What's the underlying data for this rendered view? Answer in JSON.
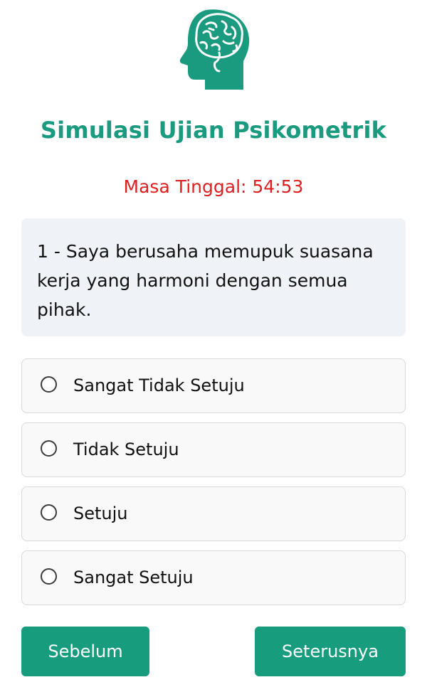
{
  "header": {
    "logo_icon": "head-brain-icon",
    "title": "Simulasi Ujian Psikometrik",
    "timer_text": "Masa Tinggal: 54:53"
  },
  "question": {
    "text": "1 - Saya berusaha memupuk suasana kerja yang harmoni dengan semua pihak."
  },
  "options": [
    {
      "label": "Sangat Tidak Setuju",
      "selected": false
    },
    {
      "label": "Tidak Setuju",
      "selected": false
    },
    {
      "label": "Setuju",
      "selected": false
    },
    {
      "label": "Sangat Setuju",
      "selected": false
    }
  ],
  "navigation": {
    "prev_label": "Sebelum",
    "next_label": "Seterusnya"
  },
  "colors": {
    "accent": "#179c7d",
    "title": "#1a9a7e",
    "timer": "#de1f1f",
    "question_bg": "#eff2f6"
  }
}
